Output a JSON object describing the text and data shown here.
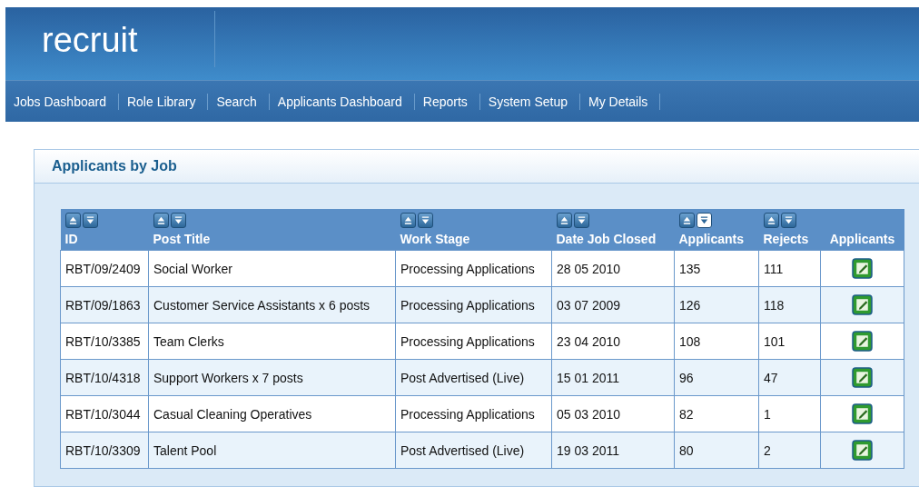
{
  "app": {
    "logo": "recruit"
  },
  "nav": [
    {
      "label": "Jobs Dashboard"
    },
    {
      "label": "Role Library"
    },
    {
      "label": "Search"
    },
    {
      "label": "Applicants Dashboard"
    },
    {
      "label": "Reports"
    },
    {
      "label": "System Setup"
    },
    {
      "label": "My Details"
    }
  ],
  "panel": {
    "title": "Applicants by Job"
  },
  "table": {
    "columns": [
      {
        "label": "ID",
        "kind": "sortable",
        "sorted_ascending": false,
        "sorted_descending": false
      },
      {
        "label": "Post Title",
        "kind": "sortable",
        "sorted_ascending": false,
        "sorted_descending": false
      },
      {
        "label": "Work Stage",
        "kind": "sortable",
        "sorted_ascending": false,
        "sorted_descending": false
      },
      {
        "label": "Date Job Closed",
        "kind": "sortable",
        "sorted_ascending": false,
        "sorted_descending": false
      },
      {
        "label": "Applicants",
        "kind": "sortable",
        "sorted_ascending": false,
        "sorted_descending": true
      },
      {
        "label": "Rejects",
        "kind": "sortable",
        "sorted_ascending": false,
        "sorted_descending": false
      },
      {
        "label": "Applicants",
        "kind": "action"
      }
    ],
    "rows": [
      {
        "cells": [
          "RBT/09/2409",
          "Social Worker",
          "Processing Applications",
          "28 05 2010",
          "135",
          "111"
        ]
      },
      {
        "cells": [
          "RBT/09/1863",
          "Customer Service Assistants x 6 posts",
          "Processing Applications",
          "03 07 2009",
          "126",
          "118"
        ]
      },
      {
        "cells": [
          "RBT/10/3385",
          "Team Clerks",
          "Processing Applications",
          "23 04 2010",
          "108",
          "101"
        ]
      },
      {
        "cells": [
          "RBT/10/4318",
          "Support Workers x 7 posts",
          "Post Advertised (Live)",
          "15 01 2011",
          "96",
          "47"
        ]
      },
      {
        "cells": [
          "RBT/10/3044",
          "Casual Cleaning Operatives",
          "Processing Applications",
          "05 03 2010",
          "82",
          "1"
        ]
      },
      {
        "cells": [
          "RBT/10/3309",
          "Talent Pool",
          "Post Advertised (Live)",
          "19 03 2011",
          "80",
          "2"
        ]
      }
    ]
  }
}
